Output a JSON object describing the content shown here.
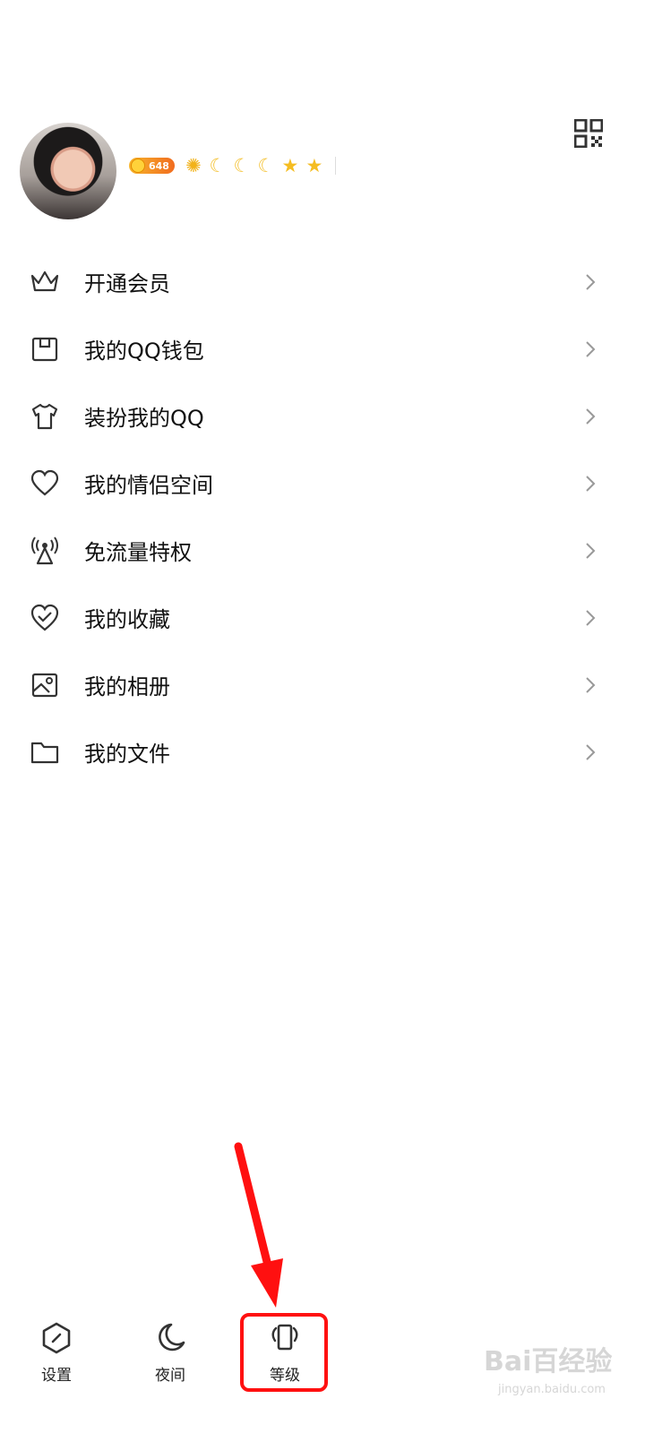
{
  "profile": {
    "coin_count": "648",
    "level_icons": [
      "sun",
      "moon",
      "moon",
      "moon",
      "star",
      "star"
    ]
  },
  "menu": [
    {
      "label": "开通会员",
      "icon": "crown-icon"
    },
    {
      "label": "我的QQ钱包",
      "icon": "wallet-icon"
    },
    {
      "label": "装扮我的QQ",
      "icon": "tshirt-icon"
    },
    {
      "label": "我的情侣空间",
      "icon": "heart-icon"
    },
    {
      "label": "免流量特权",
      "icon": "signal-tower-icon"
    },
    {
      "label": "我的收藏",
      "icon": "favorite-heart-icon"
    },
    {
      "label": "我的相册",
      "icon": "photo-album-icon"
    },
    {
      "label": "我的文件",
      "icon": "folder-icon"
    }
  ],
  "bottom_tabs": [
    {
      "label": "设置",
      "icon": "settings-hexagon-icon"
    },
    {
      "label": "夜间",
      "icon": "moon-icon"
    },
    {
      "label": "等级",
      "icon": "level-badge-icon"
    }
  ],
  "watermark": {
    "brand": "Bai百经验",
    "url": "jingyan.baidu.com"
  },
  "colors": {
    "annotation_red": "#ff1010",
    "coin_badge": "#f16c1f",
    "star_gold": "#f5bd22"
  }
}
